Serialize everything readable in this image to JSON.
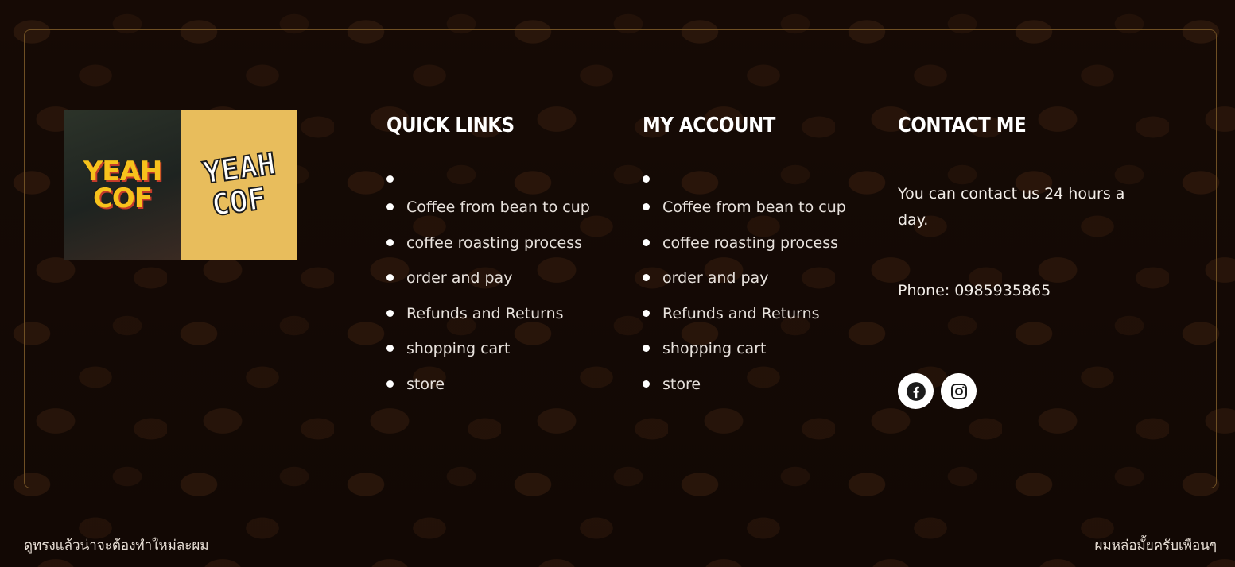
{
  "brand": {
    "logo_word_1": "YEAH",
    "logo_word_2": "COF"
  },
  "quick_links": {
    "title": "QUICK LINKS",
    "items": [
      "",
      "Coffee from bean to cup",
      "coffee roasting process",
      "order and pay",
      "Refunds and Returns",
      "shopping cart",
      "store"
    ]
  },
  "my_account": {
    "title": "MY ACCOUNT",
    "items": [
      "",
      "Coffee from bean to cup",
      "coffee roasting process",
      "order and pay",
      "Refunds and Returns",
      "shopping cart",
      "store"
    ]
  },
  "contact": {
    "title": "CONTACT ME",
    "text": "You can contact us 24 hours a day.",
    "phone": "Phone: 0985935865",
    "social": [
      "facebook-icon",
      "instagram-icon"
    ]
  },
  "bottom_bar": {
    "left_text": "ดูทรงแล้วน่าจะต้องทำใหม่ละผม",
    "right_text": "ผมหล่อมั้ยครับเพือนๆ"
  },
  "colors": {
    "background": "#1a0d07",
    "border": "#6e4f24",
    "logo_yellow": "#e8bd5c",
    "text": "#ffffff"
  }
}
